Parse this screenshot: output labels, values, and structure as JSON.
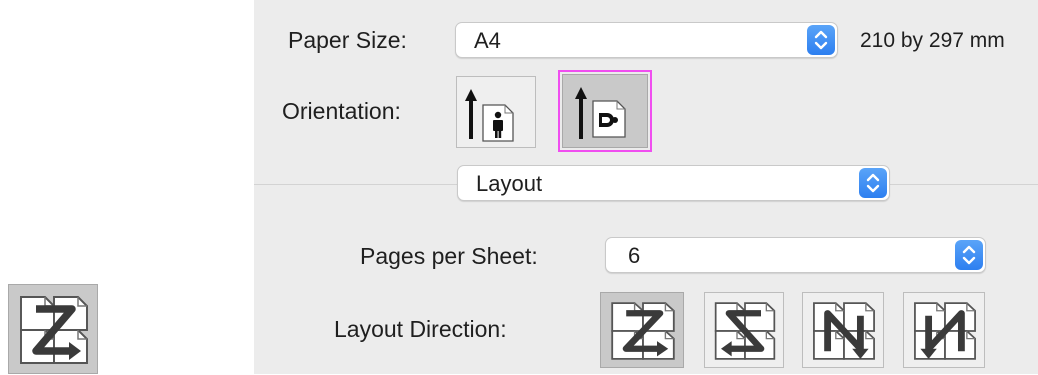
{
  "paper": {
    "label": "Paper Size:",
    "value": "A4",
    "dimensions": "210 by 297 mm"
  },
  "orientation": {
    "label": "Orientation:",
    "options": [
      {
        "name": "portrait",
        "icon": "portrait-orientation-icon",
        "selected": false
      },
      {
        "name": "landscape",
        "icon": "landscape-orientation-icon",
        "selected": true
      }
    ]
  },
  "section": {
    "value": "Layout"
  },
  "pages_per_sheet": {
    "label": "Pages per Sheet:",
    "value": "6"
  },
  "layout_direction": {
    "label": "Layout Direction:",
    "options": [
      {
        "icon": "z-direction-icon",
        "selected": true
      },
      {
        "icon": "reverse-z-direction-icon",
        "selected": false
      },
      {
        "icon": "n-direction-icon",
        "selected": false
      },
      {
        "icon": "reverse-n-direction-icon",
        "selected": false
      }
    ]
  },
  "colors": {
    "panel": "#ececec",
    "accent": "#2d7ff0",
    "highlight": "#f04ef0"
  }
}
